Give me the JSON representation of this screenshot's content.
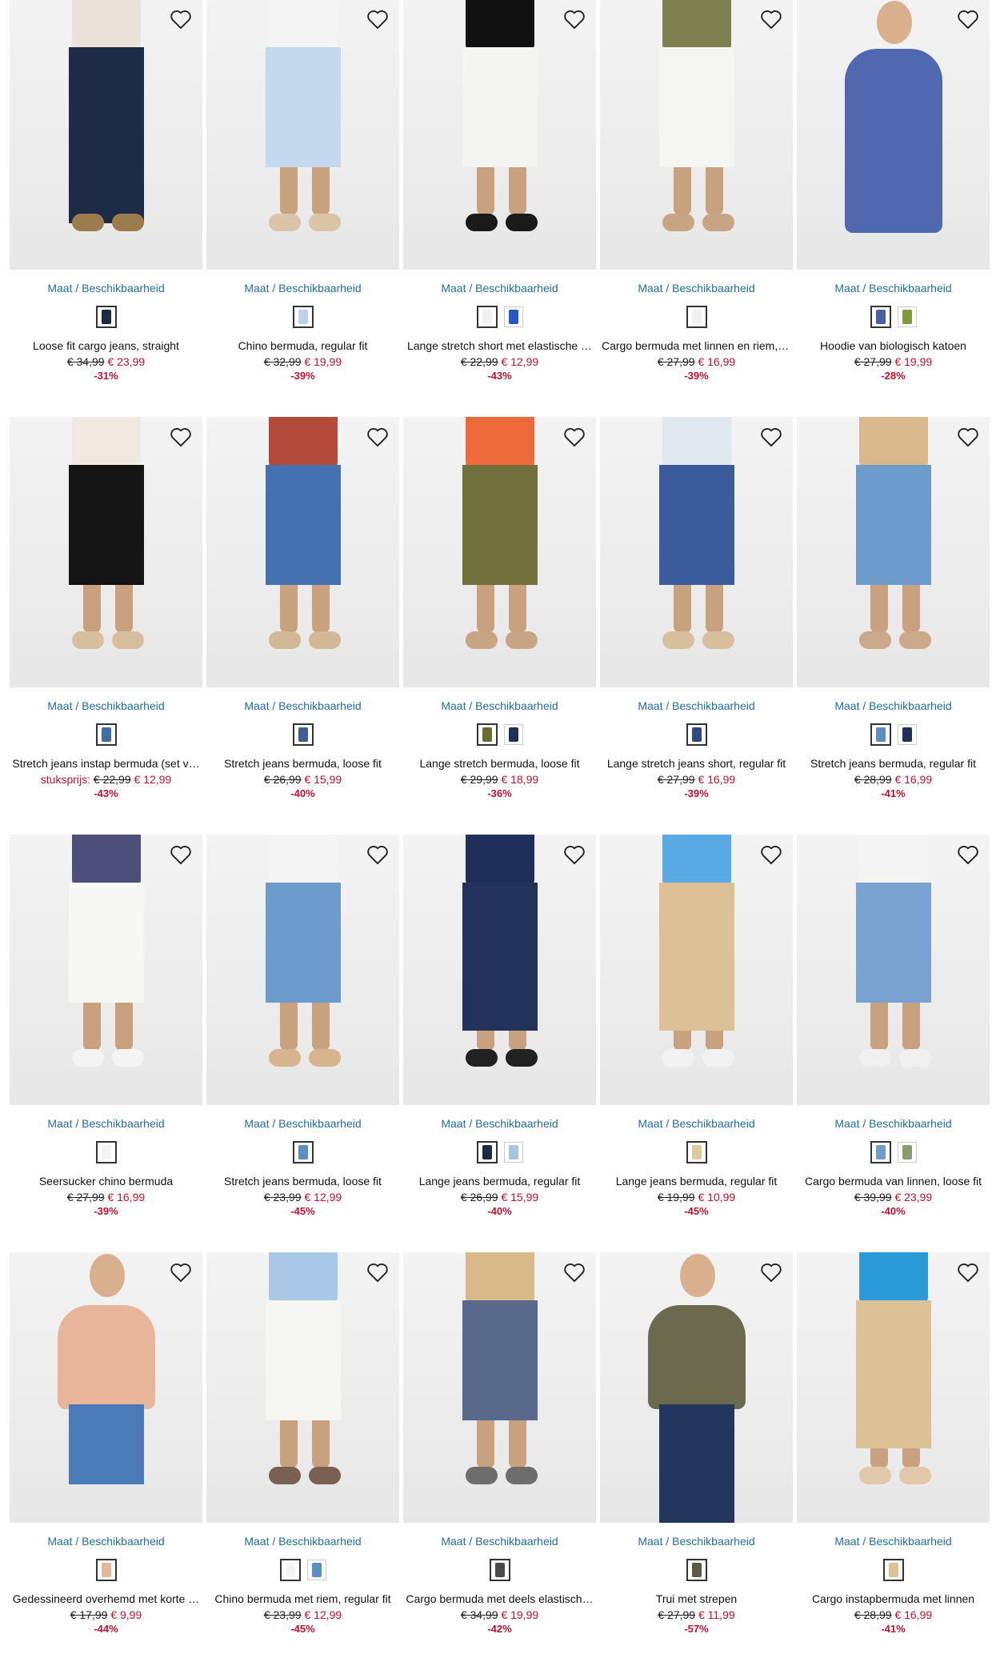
{
  "availability_label": "Maat / Beschikbaarheid",
  "products": [
    {
      "title": "Loose fit cargo jeans, straight",
      "old": "€ 34,99",
      "new": "€ 23,99",
      "discount": "-31%",
      "swatches": [
        "#1d2a44"
      ],
      "top": "#e9e2d8",
      "bottom": "#1e2b47",
      "shoe": "#9b7d4d",
      "kind": "long"
    },
    {
      "title": "Chino bermuda, regular fit",
      "old": "€ 32,99",
      "new": "€ 19,99",
      "discount": "-39%",
      "swatches": [
        "#bcd2ea"
      ],
      "top": "#f4f4f4",
      "bottom": "#c5d8ee",
      "shoe": "#d9c4a8",
      "kind": "short"
    },
    {
      "title": "Lange stretch short met elastische …",
      "old": "€ 22,99",
      "new": "€ 12,99",
      "discount": "-43%",
      "swatches": [
        "#f2f2f2",
        "#2458c8"
      ],
      "top": "#111111",
      "bottom": "#f4f4f2",
      "shoe": "#1a1a1a",
      "kind": "short"
    },
    {
      "title": "Cargo bermuda met linnen en riem, …",
      "old": "€ 27,99",
      "new": "€ 16,99",
      "discount": "-39%",
      "swatches": [
        "#f2f2f2"
      ],
      "top": "#7d8150",
      "bottom": "#f5f5f3",
      "shoe": "#c7a583",
      "kind": "short"
    },
    {
      "title": "Hoodie van biologisch katoen",
      "old": "€ 27,99",
      "new": "€ 19,99",
      "discount": "-28%",
      "swatches": [
        "#4a5fa8",
        "#7f9a3a"
      ],
      "top": "#5068b0",
      "bottom": "#4a4a4a",
      "shoe": "#555",
      "kind": "hoodie"
    },
    {
      "title": "Stretch jeans instap bermuda (set v…",
      "prefix": "stuksprijs:",
      "old": "€ 22,99",
      "new": "€ 12,99",
      "discount": "-43%",
      "swatches": [
        "#3e6ea6"
      ],
      "top": "#efe9df",
      "bottom": "#151515",
      "shoe": "#d7bf9e",
      "kind": "short"
    },
    {
      "title": "Stretch jeans bermuda, loose fit",
      "old": "€ 26,99",
      "new": "€ 15,99",
      "discount": "-40%",
      "swatches": [
        "#3b5f96"
      ],
      "top": "#b34a3a",
      "bottom": "#4472b0",
      "shoe": "#d2b894",
      "kind": "short"
    },
    {
      "title": "Lange stretch bermuda, loose fit",
      "old": "€ 29,99",
      "new": "€ 18,99",
      "discount": "-36%",
      "swatches": [
        "#6b6b34",
        "#1f2f5a"
      ],
      "top": "#ee6a3a",
      "bottom": "#72703c",
      "shoe": "#c7a583",
      "kind": "short"
    },
    {
      "title": "Lange stretch jeans short, regular fit",
      "old": "€ 27,99",
      "new": "€ 16,99",
      "discount": "-39%",
      "swatches": [
        "#2e4a85"
      ],
      "top": "#dfe8ef",
      "bottom": "#3a5c9c",
      "shoe": "#d7bf9e",
      "kind": "short"
    },
    {
      "title": "Stretch jeans bermuda, regular fit",
      "old": "€ 28,99",
      "new": "€ 16,99",
      "discount": "-41%",
      "swatches": [
        "#5b8ec4",
        "#1f2f5a"
      ],
      "top": "#d9b98c",
      "bottom": "#6d9ccc",
      "shoe": "#c9a98a",
      "kind": "short"
    },
    {
      "title": "Seersucker chino bermuda",
      "old": "€ 27,99",
      "new": "€ 16,99",
      "discount": "-39%",
      "swatches": [
        "#f4f4f4"
      ],
      "top": "#4d4f7a",
      "bottom": "#f7f7f5",
      "shoe": "#f4f4f4",
      "kind": "short"
    },
    {
      "title": "Stretch jeans bermuda, loose fit",
      "old": "€ 23,99",
      "new": "€ 12,99",
      "discount": "-45%",
      "swatches": [
        "#5b8ec4"
      ],
      "top": "#f4f4f4",
      "bottom": "#6d9ccc",
      "shoe": "#d6b48e",
      "kind": "short"
    },
    {
      "title": "Lange jeans bermuda, regular fit",
      "old": "€ 26,99",
      "new": "€ 15,99",
      "discount": "-40%",
      "swatches": [
        "#1e2b47",
        "#a9c4e0"
      ],
      "top": "#1f2f5a",
      "bottom": "#22325a",
      "shoe": "#222222",
      "kind": "long3q"
    },
    {
      "title": "Lange jeans bermuda, regular fit",
      "old": "€ 19,99",
      "new": "€ 10,99",
      "discount": "-45%",
      "swatches": [
        "#e3c89b"
      ],
      "top": "#58a9e4",
      "bottom": "#dcc096",
      "shoe": "#f2f2f2",
      "kind": "long3q"
    },
    {
      "title": "Cargo bermuda van linnen, loose fit",
      "old": "€ 39,99",
      "new": "€ 23,99",
      "discount": "-40%",
      "swatches": [
        "#6d9ccc",
        "#8a9c6a"
      ],
      "top": "#f4f4f4",
      "bottom": "#7aa2d0",
      "shoe": "#f0f0f0",
      "kind": "short"
    },
    {
      "title": "Gedessineerd overhemd met korte …",
      "old": "€ 17,99",
      "new": "€ 9,99",
      "discount": "-44%",
      "swatches": [
        "#e7b59a"
      ],
      "top": "#e7b59a",
      "bottom": "#4a7bb8",
      "shoe": "#8a6a4a",
      "kind": "shirt"
    },
    {
      "title": "Chino bermuda met riem, regular fit",
      "old": "€ 23,99",
      "new": "€ 12,99",
      "discount": "-45%",
      "swatches": [
        "#f4f4f4",
        "#5b8ec4"
      ],
      "top": "#a9c7e6",
      "bottom": "#f5f5f2",
      "shoe": "#7a6050",
      "kind": "short"
    },
    {
      "title": "Cargo bermuda met deels elastisch…",
      "old": "€ 34,99",
      "new": "€ 19,99",
      "discount": "-42%",
      "swatches": [
        "#4a4a4a"
      ],
      "top": "#d8b98a",
      "bottom": "#58698c",
      "shoe": "#6d6d6d",
      "kind": "short"
    },
    {
      "title": "Trui met strepen",
      "old": "€ 27,99",
      "new": "€ 11,99",
      "discount": "-57%",
      "swatches": [
        "#5b5a44"
      ],
      "top": "#6b6a4e",
      "bottom": "#23365e",
      "shoe": "#333",
      "kind": "sweater"
    },
    {
      "title": "Cargo instapbermuda met linnen",
      "old": "€ 28,99",
      "new": "€ 16,99",
      "discount": "-41%",
      "swatches": [
        "#dcc096"
      ],
      "top": "#2b9ad8",
      "bottom": "#dcc096",
      "shoe": "#e0c8a8",
      "kind": "long3q"
    }
  ]
}
